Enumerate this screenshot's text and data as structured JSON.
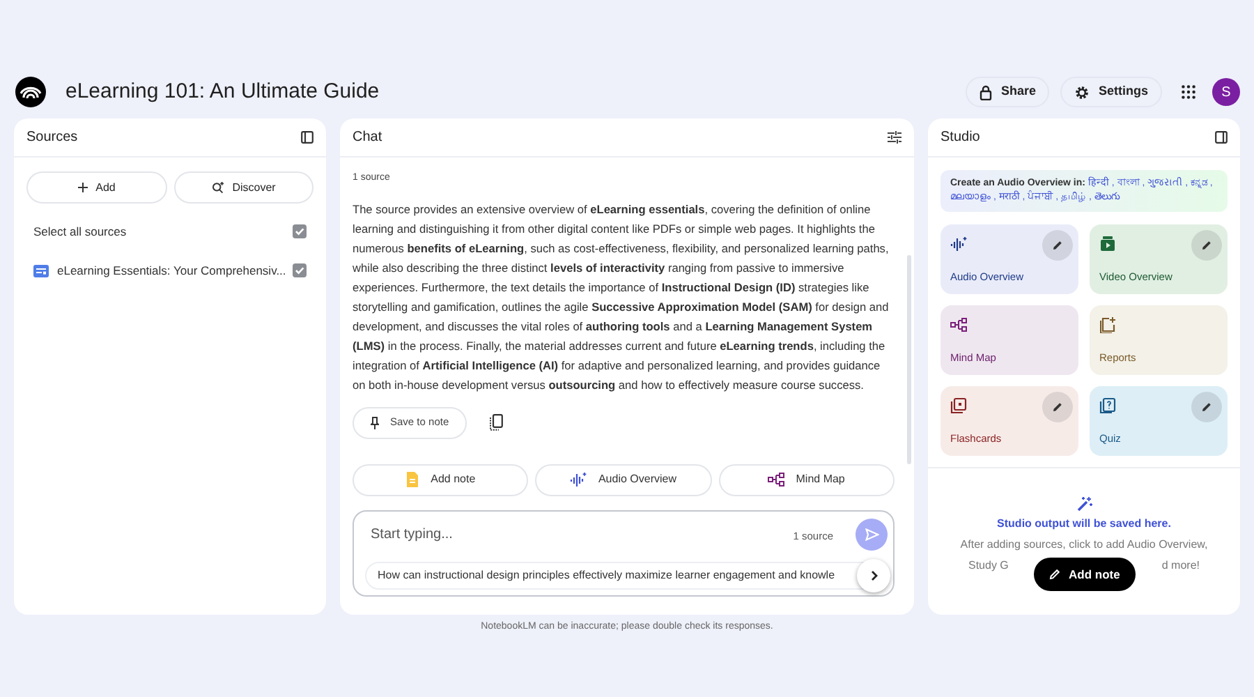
{
  "header": {
    "title": "eLearning 101: An Ultimate Guide",
    "share": "Share",
    "settings": "Settings",
    "avatar": "S"
  },
  "sources": {
    "title": "Sources",
    "add": "Add",
    "discover": "Discover",
    "select_all": {
      "label": "Select all sources",
      "checked": true
    },
    "items": [
      {
        "label": "eLearning Essentials: Your Comprehensiv...",
        "checked": true
      }
    ]
  },
  "chat": {
    "title": "Chat",
    "source_count": "1 source",
    "summary": "The source provides an extensive overview of **eLearning essentials**, covering the definition of online learning and distinguishing it from other digital content like PDFs or simple web pages. It highlights the numerous **benefits of eLearning**, such as cost-effectiveness, flexibility, and personalized learning paths, while also describing the three distinct **levels of interactivity** ranging from passive to immersive experiences. Furthermore, the text details the importance of **Instructional Design (ID)** strategies like storytelling and gamification, outlines the agile **Successive Approximation Model (SAM)** for design and development, and discusses the vital roles of **authoring tools** and a **Learning Management System (LMS)** in the process. Finally, the material addresses current and future **eLearning trends**, including the integration of **Artificial Intelligence (AI)** for adaptive and personalized learning, and provides guidance on both in-house development versus **outsourcing** and how to effectively measure course success.",
    "save_to_note": "Save to note",
    "actions": [
      {
        "kind": "note",
        "label": "Add note"
      },
      {
        "kind": "audio",
        "label": "Audio Overview"
      },
      {
        "kind": "mindmap",
        "label": "Mind Map"
      }
    ],
    "input": {
      "placeholder": "Start typing...",
      "source_count": "1 source"
    },
    "suggestion": "How can instructional design principles effectively maximize learner engagement and knowle"
  },
  "studio": {
    "title": "Studio",
    "audio_prompt": "Create an Audio Overview in:",
    "language_separator": ",",
    "languages": [
      "हिन्दी",
      "বাংলা",
      "ગુજરાતી",
      "ಕನ್ನಡ",
      "മലയാളം",
      "मराठी",
      "ਪੰਜਾਬੀ",
      "தமிழ்",
      "తెలుగు"
    ],
    "tiles": [
      {
        "kind": "audio",
        "label": "Audio Overview",
        "color": "#e9ecf8",
        "editable": true
      },
      {
        "kind": "video",
        "label": "Video Overview",
        "color": "#e1efe3",
        "editable": true
      },
      {
        "kind": "mindmap",
        "label": "Mind Map",
        "color": "#efe7ef",
        "editable": false
      },
      {
        "kind": "reports",
        "label": "Reports",
        "color": "#f3f1e8",
        "editable": false
      },
      {
        "kind": "flashcards",
        "label": "Flashcards",
        "color": "#f7ebe8",
        "editable": true
      },
      {
        "kind": "quiz",
        "label": "Quiz",
        "color": "#ddeef6",
        "editable": true
      }
    ],
    "output_title": "Studio output will be saved here.",
    "output_text": [
      "After adding sources, click to add Audio Overview,",
      "Study G",
      "d more!"
    ],
    "add_note": "Add note"
  },
  "footer": "NotebookLM can be inaccurate; please double check its responses."
}
